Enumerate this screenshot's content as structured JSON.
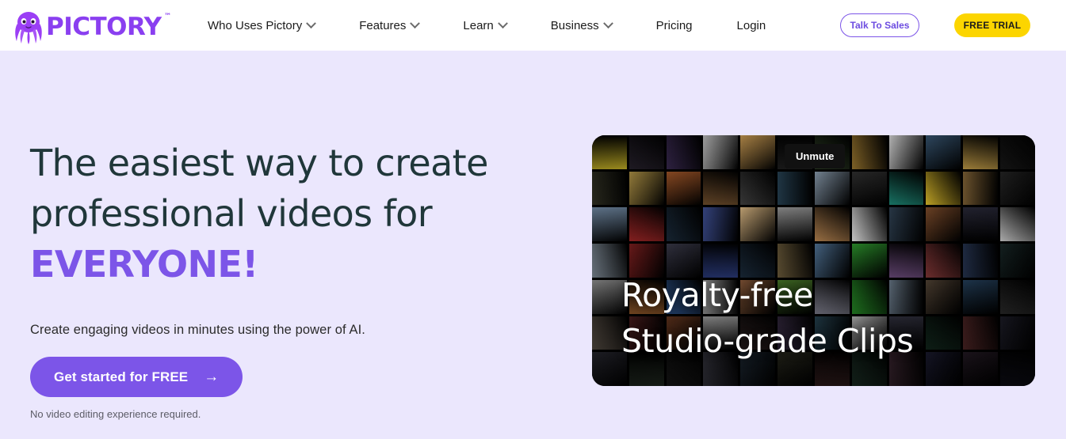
{
  "brand": {
    "name": "PICTORY",
    "trademark": "™",
    "logo_icon": "octopus-mascot-icon",
    "purple": "#8a3ff0"
  },
  "header": {
    "background": "#ffffff",
    "nav": [
      {
        "label": "Who Uses Pictory",
        "has_dropdown": true
      },
      {
        "label": "Features",
        "has_dropdown": true
      },
      {
        "label": "Learn",
        "has_dropdown": true
      },
      {
        "label": "Business",
        "has_dropdown": true
      },
      {
        "label": "Pricing",
        "has_dropdown": false
      },
      {
        "label": "Login",
        "has_dropdown": false
      }
    ],
    "talk_to_sales": "Talk To Sales",
    "free_trial": "FREE TRIAL",
    "talk_to_sales_color": "#6c4ce0",
    "free_trial_color": "#fcd500"
  },
  "hero": {
    "headline_line1": "The easiest way to create",
    "headline_line2": "professional videos for",
    "headline_accent": "EVERYONE!",
    "headline_color": "#20373a",
    "accent_color": "#7c55e8",
    "subhead": "Create engaging videos in minutes using the power of AI.",
    "cta_label": "Get started for FREE",
    "cta_arrow": "→",
    "cta_color": "#7c55e8",
    "note": "No video editing experience required.",
    "background": "#ebe7fd"
  },
  "video": {
    "unmute_label": "Unmute",
    "caption_line1": "Royalty-free",
    "caption_line2": "Studio-grade Clips",
    "thumbnail_colors": [
      "#d8c32a",
      "#2a2430",
      "#3a2a52",
      "#c9c9c9",
      "#c99a52",
      "#1a1a1a",
      "#2a3a22",
      "#8a6a2a",
      "#d8d8d8",
      "#3a5a78",
      "#c9a24a",
      "#1a1a1a",
      "#3a3a2a",
      "#c9a850",
      "#a85a2a",
      "#6a4a2a",
      "#3a3a3a",
      "#223a4a",
      "#7a8a9a",
      "#2a2a2a",
      "#1a7a6a",
      "#d8b82a",
      "#8a6a3a",
      "#2a2a2a",
      "#8aa8c8",
      "#b02a2a",
      "#1a2a3a",
      "#3a4a8a",
      "#c8a878",
      "#8a8a8a",
      "#a87a4a",
      "#d8d8d8",
      "#2a3a4a",
      "#7a4a2a",
      "#2a2a3a",
      "#e8e8e8",
      "#a8b8c8",
      "#8a2222",
      "#3a3a4a",
      "#2a3a7a",
      "#1a2a3a",
      "#6a5a3a",
      "#4a6a8a",
      "#2a8a2a",
      "#6a4a7a",
      "#8a3a3a",
      "#2a3a5a",
      "#1a2a2a",
      "#c8c8c8",
      "#c87a3a",
      "#3a6ab0",
      "#b8b8b8",
      "#8a5a3a",
      "#4a7a2a",
      "#8a8a9a",
      "#2a9a2a",
      "#6a7a8a",
      "#5a4a3a",
      "#2a4a6a",
      "#3a3a3a",
      "#9a8a7a",
      "#6a2a2a",
      "#8a4a2a",
      "#c8c8c8",
      "#3a2a2a",
      "#4a3a5a",
      "#2a4a5a",
      "#d8d8d8",
      "#3a3a4a",
      "#1a3a2a",
      "#7a3a3a",
      "#2a2a3a",
      "#4a4a5a",
      "#3a4a3a",
      "#2a2a2a",
      "#5a5a6a",
      "#2a3a4a",
      "#3a3a2a",
      "#4a2a2a",
      "#2a4a3a",
      "#5a3a4a",
      "#2a2a4a",
      "#3a2a3a",
      "#1a1a2a",
      "#6a5a4a",
      "#2a3a3a",
      "#4a3a2a",
      "#3a4a5a",
      "#5a4a2a",
      "#2a2a5a",
      "#3a5a4a",
      "#4a4a2a",
      "#2a3a2a",
      "#5a2a3a",
      "#3a3a5a",
      "#2a4a4a"
    ]
  }
}
